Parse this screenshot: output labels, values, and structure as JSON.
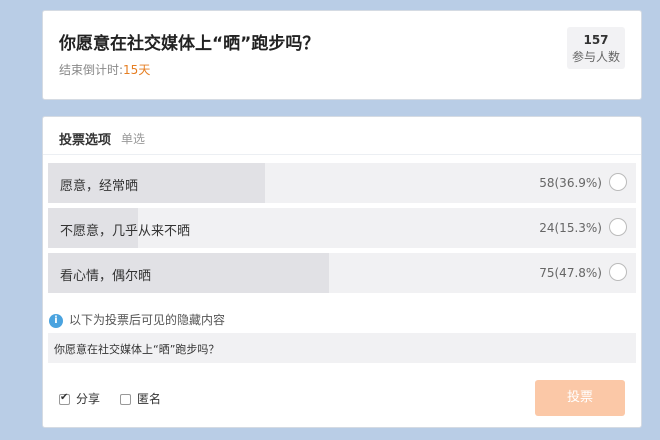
{
  "header": {
    "title": "你愿意在社交媒体上“晒”跑步吗？",
    "countdown_label": "结束倒计时:",
    "countdown_value": "15天",
    "participants_count": "157",
    "participants_label": "参与人数"
  },
  "vote": {
    "heading": "投票选项",
    "type": "单选",
    "options": [
      {
        "label": "愿意，经常晒",
        "count": "58(36.9%)",
        "percent": 36.9
      },
      {
        "label": "不愿意，几乎从来不晒",
        "count": "24(15.3%)",
        "percent": 15.3
      },
      {
        "label": "看心情，偶尔晒",
        "count": "75(47.8%)",
        "percent": 47.8
      }
    ],
    "hidden_note": "以下为投票后可见的隐藏内容",
    "hidden_content": "你愿意在社交媒体上“晒”跑步吗？",
    "share_label": "分享",
    "share_checked": true,
    "anonymous_label": "匿名",
    "anonymous_checked": false,
    "submit_label": "投票"
  },
  "colors": {
    "accent": "#e67e22",
    "submit_bg": "#fbc8a7",
    "info_icon": "#4aa3df"
  }
}
